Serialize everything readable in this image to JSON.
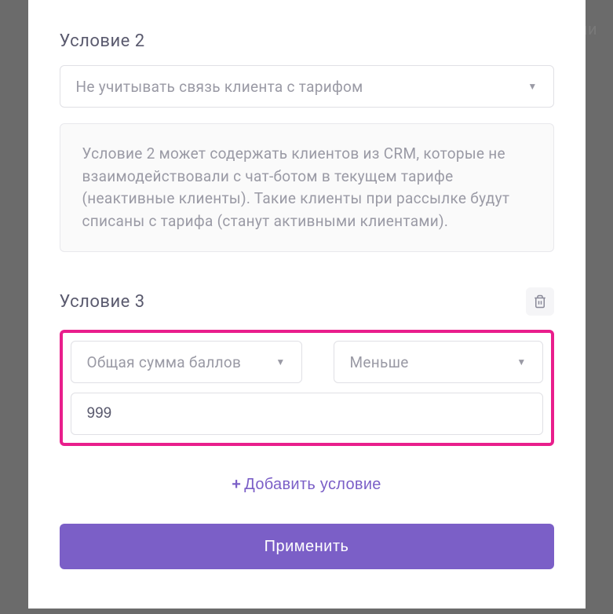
{
  "bg_text": "рии",
  "condition2": {
    "label": "Условие 2",
    "select_value": "Не учитывать связь клиента с тарифом",
    "info_text": "Условие 2 может содержать клиентов из CRM, которые не взаимодействовали с чат-ботом в текущем тарифе (неактивные клиенты). Такие клиенты при рассылке будут списаны с тарифа (станут активными клиентами)."
  },
  "condition3": {
    "label": "Условие 3",
    "field_select": "Общая сумма баллов",
    "operator_select": "Меньше",
    "value": "999"
  },
  "add_condition_label": "Добавить условие",
  "apply_label": "Применить"
}
